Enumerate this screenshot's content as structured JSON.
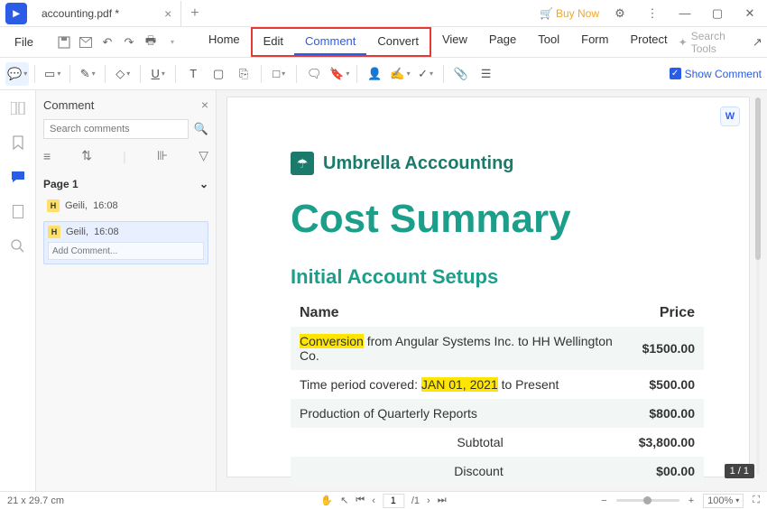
{
  "title": {
    "tab": "accounting.pdf *"
  },
  "buynow": "Buy Now",
  "menu": {
    "file": "File",
    "home": "Home",
    "edit": "Edit",
    "comment": "Comment",
    "convert": "Convert",
    "view": "View",
    "page": "Page",
    "tool": "Tool",
    "form": "Form",
    "protect": "Protect",
    "search_placeholder": "Search Tools"
  },
  "toolbar": {
    "show_comment": "Show Comment"
  },
  "sidepanel": {
    "title": "Comment",
    "search_placeholder": "Search comments",
    "page": "Page 1",
    "items": [
      {
        "badge": "H",
        "author": "Geili,",
        "time": "16:08"
      },
      {
        "badge": "H",
        "author": "Geili,",
        "time": "16:08"
      }
    ],
    "add_placeholder": "Add Comment..."
  },
  "doc": {
    "brand": "Umbrella Acccounting",
    "title": "Cost Summary",
    "section": "Initial Account Setups",
    "col_name": "Name",
    "col_price": "Price",
    "rows": [
      {
        "hl": "Conversion",
        "rest": " from Angular Systems Inc. to HH Wellington Co.",
        "price": "$1500.00",
        "striped": true
      },
      {
        "pre": "Time period covered: ",
        "hl": "JAN 01, 2021",
        "rest": " to Present",
        "price": "$500.00",
        "striped": false
      },
      {
        "text": "Production of Quarterly Reports",
        "price": "$800.00",
        "striped": true
      }
    ],
    "subtotal_label": "Subtotal",
    "subtotal": "$3,800.00",
    "discount_label": "Discount",
    "discount": "$00.00",
    "page_badge": "1 / 1"
  },
  "status": {
    "dim": "21 x 29.7 cm",
    "page_cur": "1",
    "page_total": "/1",
    "zoom": "100%"
  }
}
